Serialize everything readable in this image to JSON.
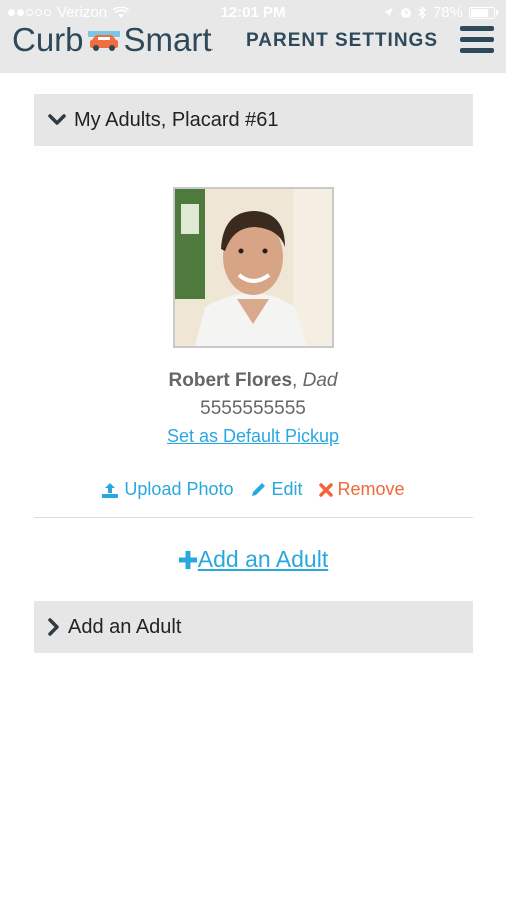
{
  "status_bar": {
    "carrier": "Verizon",
    "time": "12:01 PM",
    "battery": "78%",
    "battery_level": 0.78,
    "signal_bars": 2
  },
  "header": {
    "logo_left": "Curb",
    "logo_right": "Smart",
    "logo_tm": ".",
    "title": "PARENT SETTINGS"
  },
  "sections": {
    "my_adults_label": "My Adults, Placard #61",
    "add_adult_section_label": "Add an Adult"
  },
  "adult": {
    "name": "Robert Flores",
    "separator": ", ",
    "relation": "Dad",
    "phone": "5555555555",
    "default_pickup_label": "Set as Default Pickup"
  },
  "actions": {
    "upload_label": "Upload Photo",
    "edit_label": "Edit",
    "remove_label": "Remove"
  },
  "add_adult_link": " Add an Adult",
  "colors": {
    "brand": "#2e4a5a",
    "link": "#29a8df",
    "danger": "#f0673a"
  }
}
